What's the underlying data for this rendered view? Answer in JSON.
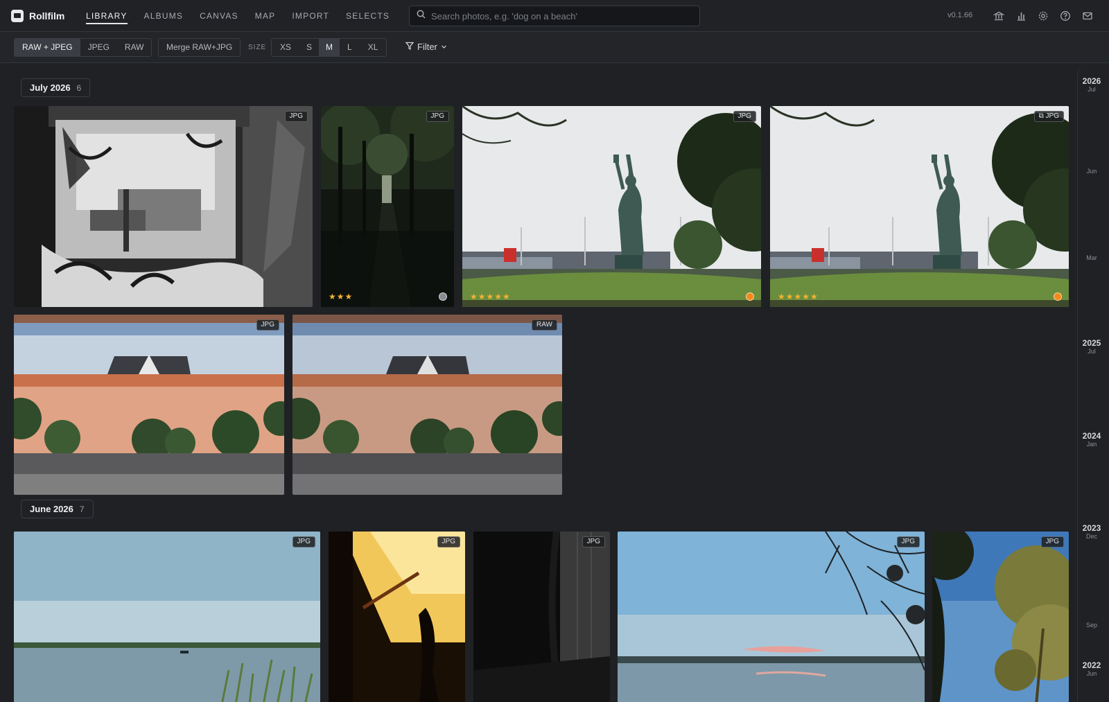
{
  "app": {
    "name": "Rollfilm",
    "version": "v0.1.66"
  },
  "nav": [
    {
      "label": "LIBRARY",
      "active": true
    },
    {
      "label": "ALBUMS",
      "active": false
    },
    {
      "label": "CANVAS",
      "active": false
    },
    {
      "label": "MAP",
      "active": false
    },
    {
      "label": "IMPORT",
      "active": false
    },
    {
      "label": "SELECTS",
      "active": false
    }
  ],
  "search": {
    "placeholder": "Search photos, e.g. 'dog on a beach'",
    "value": ""
  },
  "toolbar": {
    "format_options": [
      {
        "label": "RAW + JPEG",
        "active": true
      },
      {
        "label": "JPEG",
        "active": false
      },
      {
        "label": "RAW",
        "active": false
      }
    ],
    "merge_label": "Merge RAW+JPG",
    "size_label": "SIZE",
    "size_options": [
      {
        "label": "XS",
        "active": false
      },
      {
        "label": "S",
        "active": false
      },
      {
        "label": "M",
        "active": true
      },
      {
        "label": "L",
        "active": false
      },
      {
        "label": "XL",
        "active": false
      }
    ],
    "filter_label": "Filter"
  },
  "groups": [
    {
      "title": "July 2026",
      "count": "6",
      "photos": [
        {
          "badge": "JPG",
          "stars": "",
          "label_color": "",
          "scene": "graffiti-bw"
        },
        {
          "badge": "JPG",
          "stars": "★★★",
          "label_color": "gray",
          "scene": "dark-forest"
        },
        {
          "badge": "JPG",
          "stars": "★★★★★",
          "label_color": "orange",
          "scene": "liberty-statue"
        },
        {
          "badge": "⧉ JPG",
          "stars": "★★★★★",
          "label_color": "orange",
          "scene": "liberty-statue"
        },
        {
          "badge": "JPG",
          "stars": "",
          "label_color": "",
          "scene": "pink-wall"
        },
        {
          "badge": "RAW",
          "stars": "",
          "label_color": "",
          "scene": "pink-wall-raw"
        }
      ]
    },
    {
      "title": "June 2026",
      "count": "7",
      "photos": [
        {
          "badge": "JPG",
          "scene": "lake-reeds"
        },
        {
          "badge": "JPG",
          "scene": "golden-window"
        },
        {
          "badge": "JPG",
          "scene": "dark-curtain"
        },
        {
          "badge": "JPG",
          "scene": "sunset-lake"
        },
        {
          "badge": "JPG",
          "scene": "olive-tree"
        }
      ]
    }
  ],
  "timeline": [
    {
      "year": "2026",
      "month": "Jul"
    },
    {
      "year": "",
      "month": "Jun"
    },
    {
      "year": "",
      "month": "Mar"
    },
    {
      "year": "2025",
      "month": "Jul"
    },
    {
      "year": "2024",
      "month": "Jan"
    },
    {
      "year": "2023",
      "month": "Dec"
    },
    {
      "year": "",
      "month": "Sep"
    },
    {
      "year": "2022",
      "month": "Jun"
    }
  ],
  "icons": [
    "search-icon",
    "bank-icon",
    "stats-icon",
    "gear-icon",
    "help-icon",
    "mail-icon",
    "filter-icon",
    "chevron-down-icon"
  ],
  "colors": {
    "star": "#f2b233",
    "label_orange": "#f28a1a",
    "label_gray": "#8a8d92"
  }
}
